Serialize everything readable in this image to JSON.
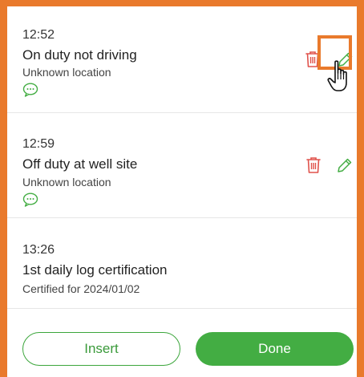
{
  "entries": [
    {
      "time": "12:52",
      "status": "On duty not driving",
      "location": "Unknown location",
      "has_comment": true,
      "actions": [
        "trash-icon",
        "pencil-icon"
      ]
    },
    {
      "time": "12:59",
      "status": "Off duty at well site",
      "location": "Unknown location",
      "has_comment": true,
      "actions": [
        "trash-icon",
        "pencil-icon"
      ]
    },
    {
      "time": "13:26",
      "status": "1st daily log certification",
      "location": "Certified for 2024/01/02",
      "has_comment": false,
      "actions": []
    }
  ],
  "buttons": {
    "insert_label": "Insert",
    "done_label": "Done"
  },
  "colors": {
    "accent_green": "#43ad43",
    "delete_red": "#e0524b",
    "highlight_orange": "#e97a2c"
  }
}
